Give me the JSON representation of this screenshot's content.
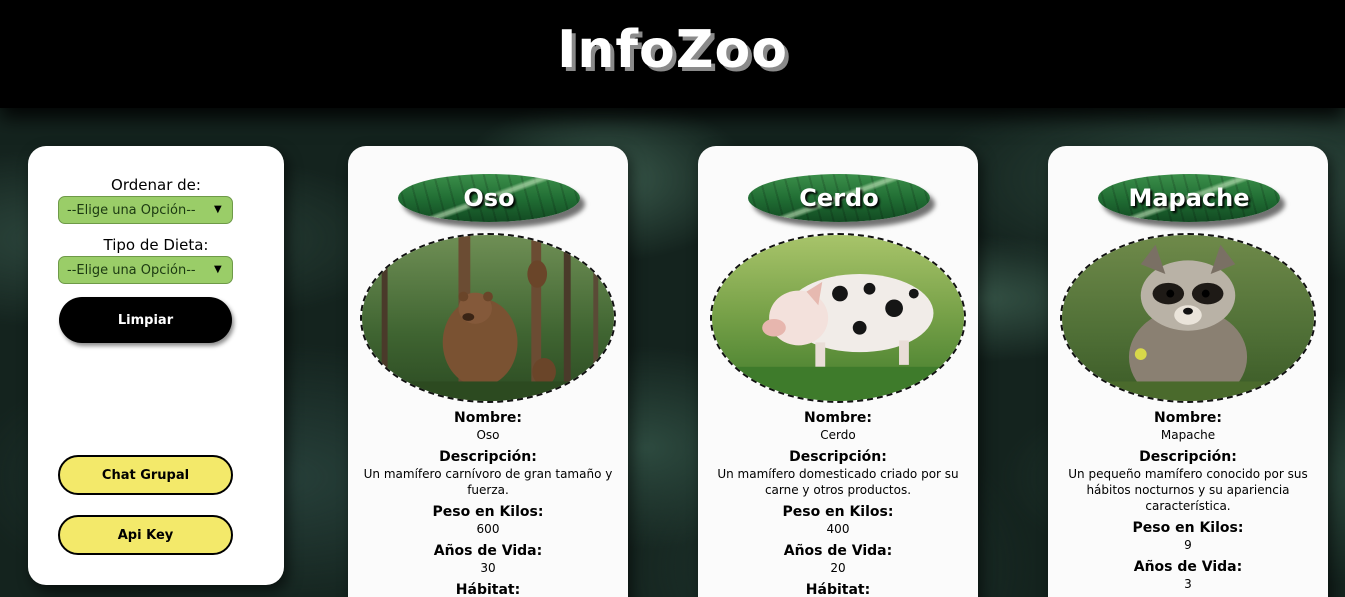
{
  "header": {
    "title": "InfoZoo"
  },
  "sidebar": {
    "sort_label": "Ordenar de:",
    "sort_value": "--Elige una Opción--",
    "diet_label": "Tipo de Dieta:",
    "diet_value": "--Elige una Opción--",
    "clear_button": "Limpiar",
    "chat_button": "Chat Grupal",
    "api_button": "Api Key"
  },
  "labels": {
    "name": "Nombre:",
    "description": "Descripción:",
    "weight": "Peso en Kilos:",
    "lifespan": "Años de Vida:",
    "habitat": "Hábitat:"
  },
  "animals": [
    {
      "title": "Oso",
      "name": "Oso",
      "description": "Un mamífero carnívoro de gran tamaño y fuerza.",
      "weight": "600",
      "lifespan": "30",
      "image": "bear-photo"
    },
    {
      "title": "Cerdo",
      "name": "Cerdo",
      "description": "Un mamífero domesticado criado por su carne y otros productos.",
      "weight": "400",
      "lifespan": "20",
      "image": "pig-photo"
    },
    {
      "title": "Mapache",
      "name": "Mapache",
      "description": "Un pequeño mamífero conocido por sus hábitos nocturnos y su apariencia característica.",
      "weight": "9",
      "lifespan": "3",
      "image": "raccoon-photo"
    }
  ]
}
